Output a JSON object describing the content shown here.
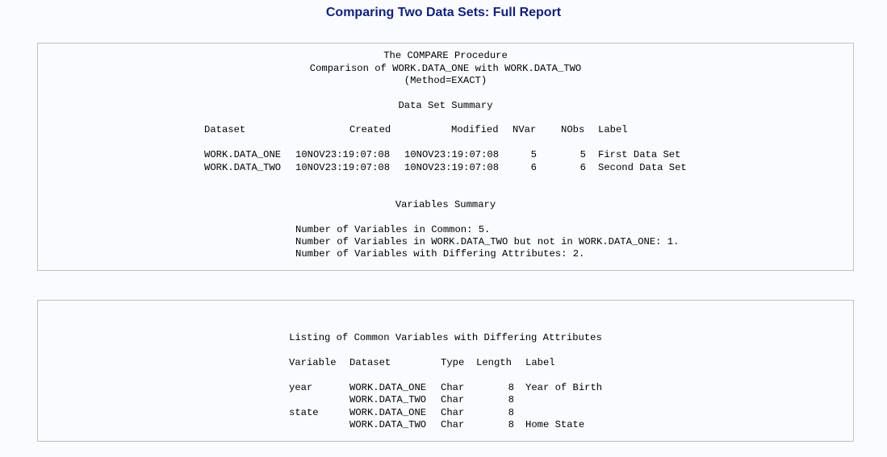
{
  "page": {
    "title": "Comparing Two Data Sets: Full Report"
  },
  "compare_report": {
    "procedure_title": "The COMPARE Procedure",
    "comparison_line": "Comparison of WORK.DATA_ONE with WORK.DATA_TWO",
    "method_line": "(Method=EXACT)",
    "dataset_summary": {
      "heading": "Data Set Summary",
      "columns": {
        "dataset": "Dataset",
        "created": "Created",
        "modified": "Modified",
        "nvar": "NVar",
        "nobs": "NObs",
        "label": "Label"
      },
      "rows": [
        {
          "dataset": "WORK.DATA_ONE",
          "created": "10NOV23:19:07:08",
          "modified": "10NOV23:19:07:08",
          "nvar": "5",
          "nobs": "5",
          "label": "First Data Set"
        },
        {
          "dataset": "WORK.DATA_TWO",
          "created": "10NOV23:19:07:08",
          "modified": "10NOV23:19:07:08",
          "nvar": "6",
          "nobs": "6",
          "label": "Second Data Set"
        }
      ]
    },
    "variables_summary": {
      "heading": "Variables Summary",
      "lines": [
        "Number of Variables in Common: 5.",
        "Number of Variables in WORK.DATA_TWO but not in WORK.DATA_ONE: 1.",
        "Number of Variables with Differing Attributes: 2."
      ]
    }
  },
  "differing_attributes": {
    "heading": "Listing of Common Variables with Differing Attributes",
    "columns": {
      "variable": "Variable",
      "dataset": "Dataset",
      "type": "Type",
      "length": "Length",
      "label": "Label"
    },
    "rows": [
      {
        "variable": "year",
        "dataset": "WORK.DATA_ONE",
        "type": "Char",
        "length": "8",
        "label": "Year of Birth"
      },
      {
        "variable": "",
        "dataset": "WORK.DATA_TWO",
        "type": "Char",
        "length": "8",
        "label": ""
      },
      {
        "variable": "state",
        "dataset": "WORK.DATA_ONE",
        "type": "Char",
        "length": "8",
        "label": ""
      },
      {
        "variable": "",
        "dataset": "WORK.DATA_TWO",
        "type": "Char",
        "length": "8",
        "label": "Home State"
      }
    ]
  }
}
